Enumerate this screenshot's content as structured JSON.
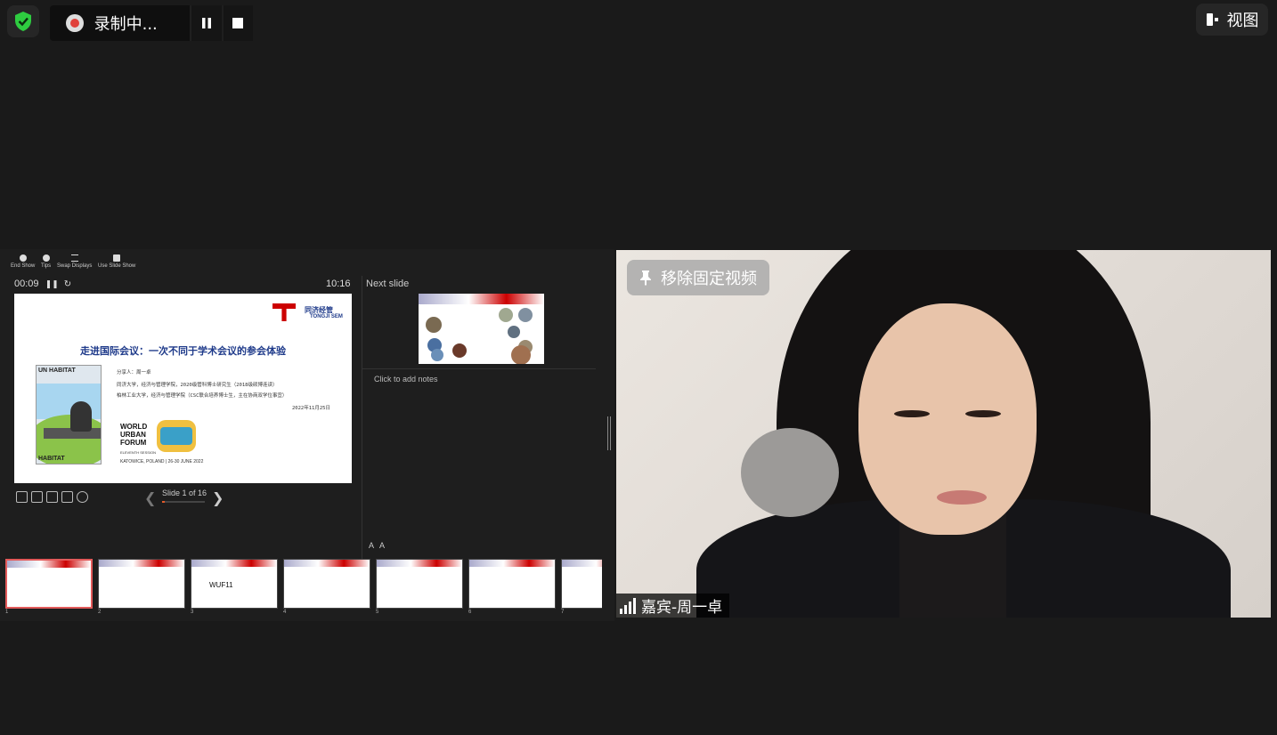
{
  "recording": {
    "status_label": "录制中..."
  },
  "view_button": {
    "label": "视图"
  },
  "presenter": {
    "toolbar": [
      {
        "label": "End Show",
        "icon": "close-icon"
      },
      {
        "label": "Tips",
        "icon": "info-icon"
      },
      {
        "label": "Swap Displays",
        "icon": "swap-icon"
      },
      {
        "label": "Use Slide Show",
        "icon": "slideshow-icon"
      }
    ],
    "elapsed": "00:09",
    "clock": "10:16",
    "next_slide_label": "Next slide",
    "notes_placeholder": "Click to add notes",
    "slide_counter": "Slide 1 of 16",
    "progress_fraction": 0.0625,
    "font_buttons": [
      "A",
      "A"
    ],
    "current_slide": {
      "title": "走进国际会议：一次不同于学术会议的参会体验",
      "lines": [
        "分享人：周一卓",
        "同济大学，经济与管理学院，2020级管科博士研究生（2018级硕博连读）",
        "柏林工业大学，经济与管理学院（CSC联合培养博士生，主在协商双学位事宜）",
        "2022年11月25日"
      ],
      "logo_text": "同济经管",
      "logo_sub": "TONGJI SEM",
      "poster_top": "UN HABITAT",
      "poster_bottom": "HABITAT",
      "wuf_lines": [
        "WORLD",
        "URBAN",
        "FORUM"
      ],
      "wuf_session": "ELEVENTH SESSION",
      "wuf_date": "KATOWICE, POLAND | 26-30 JUNE 2022"
    },
    "thumbnails": [
      {
        "num": "1",
        "active": true
      },
      {
        "num": "2",
        "active": false
      },
      {
        "num": "3",
        "active": false,
        "label": "WUF11"
      },
      {
        "num": "4",
        "active": false
      },
      {
        "num": "5",
        "active": false
      },
      {
        "num": "6",
        "active": false
      },
      {
        "num": "7",
        "active": false
      }
    ]
  },
  "video": {
    "unpin_label": "移除固定视频",
    "participant_name": "嘉宾-周一卓"
  },
  "colors": {
    "background": "#1a1a1a",
    "record_red": "#e0413a",
    "shield_green": "#2ecc40",
    "slide_title_blue": "#1e3a8a",
    "active_thumb": "#e25a5a"
  }
}
